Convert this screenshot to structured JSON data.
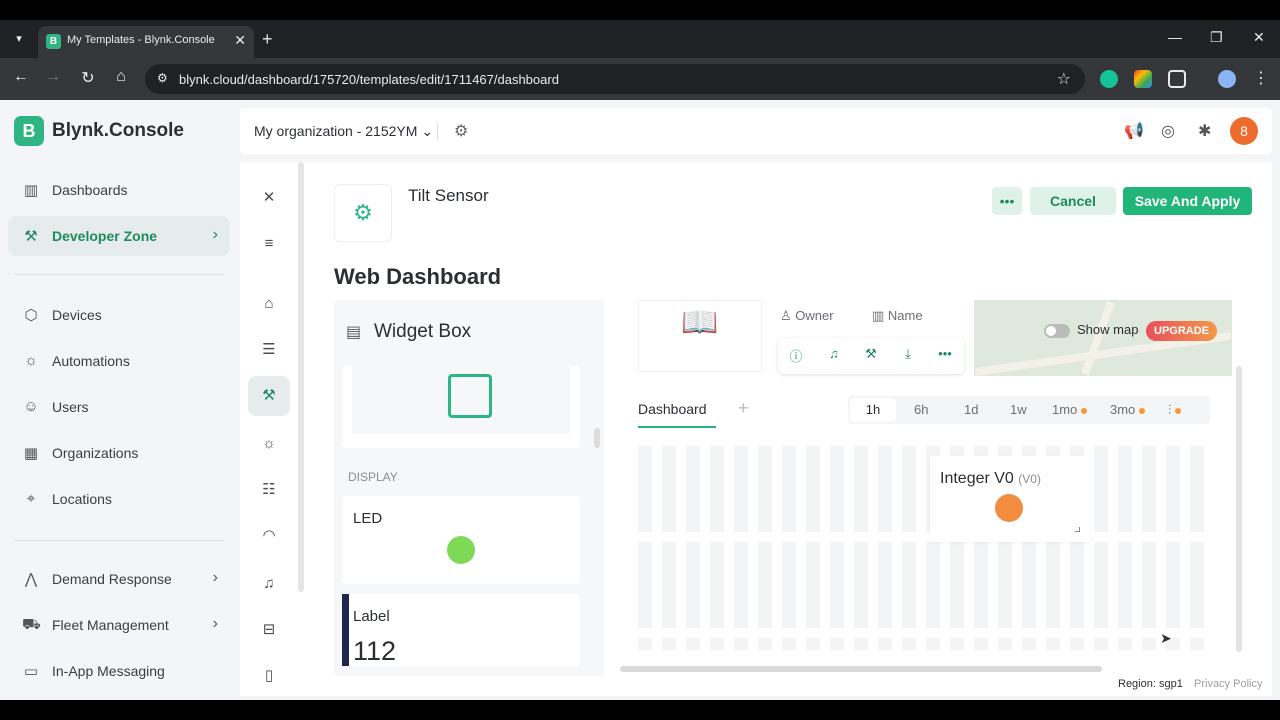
{
  "browser": {
    "tab_title": "My Templates - Blynk.Console",
    "favicon_letter": "B",
    "url": "blynk.cloud/dashboard/175720/templates/edit/1711467/dashboard"
  },
  "app": {
    "logo_letter": "B",
    "logo_text": "Blynk.Console",
    "organization": "My organization - 2152YM",
    "avatar_initial": "8"
  },
  "sidebar": {
    "items": [
      {
        "label": "Dashboards",
        "icon": "bar-chart-icon"
      },
      {
        "label": "Developer Zone",
        "icon": "tools-icon"
      },
      {
        "label": "Devices",
        "icon": "cube-icon"
      },
      {
        "label": "Automations",
        "icon": "automation-icon"
      },
      {
        "label": "Users",
        "icon": "users-icon"
      },
      {
        "label": "Organizations",
        "icon": "building-icon"
      },
      {
        "label": "Locations",
        "icon": "pin-icon"
      },
      {
        "label": "Demand Response",
        "icon": "demand-icon"
      },
      {
        "label": "Fleet Management",
        "icon": "truck-icon"
      },
      {
        "label": "In-App Messaging",
        "icon": "chat-icon"
      }
    ]
  },
  "template": {
    "name": "Tilt Sensor",
    "more_label": "•••",
    "cancel_label": "Cancel",
    "save_label": "Save And Apply",
    "page_title": "Web Dashboard"
  },
  "widget_box": {
    "title": "Widget Box",
    "section_display": "DISPLAY",
    "led_title": "LED",
    "label_title": "Label",
    "label_value": "112",
    "led_color": "#7ed957"
  },
  "device_panel": {
    "owner_label": "Owner",
    "name_label": "Name",
    "show_map": "Show map",
    "upgrade": "UPGRADE"
  },
  "dashboard": {
    "tab_label": "Dashboard",
    "add_tab": "+",
    "ranges": [
      "1h",
      "6h",
      "1d",
      "1w",
      "1mo",
      "3mo"
    ],
    "selected_range": "1h",
    "widget_title": "Integer V0",
    "widget_pin": "(V0)",
    "widget_color": "#f28c3f"
  },
  "footer": {
    "region": "Region: sgp1",
    "privacy": "Privacy Policy"
  }
}
